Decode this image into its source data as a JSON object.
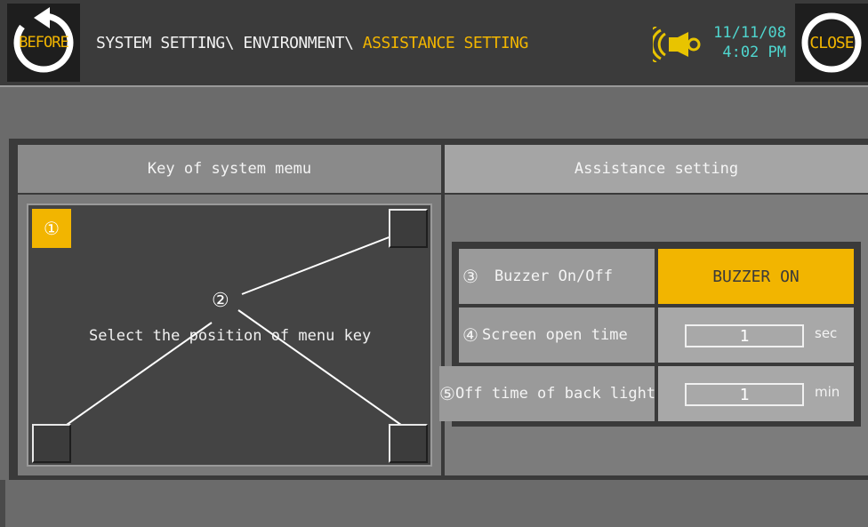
{
  "header": {
    "before_label": "BEFORE",
    "close_label": "CLOSE",
    "breadcrumb_path": "SYSTEM SETTING\\ ENVIRONMENT\\ ",
    "breadcrumb_current": "ASSISTANCE SETTING",
    "date": "11/11/08",
    "time": "4:02 PM",
    "buzzer_icon": "buzzer-icon"
  },
  "left_panel": {
    "title": "Key of system memu",
    "marker_1": "①",
    "marker_2": "②",
    "instruction": "Select the position of menu key"
  },
  "right_panel": {
    "title": "Assistance setting",
    "rows": [
      {
        "marker": "③",
        "label": "Buzzer On/Off",
        "value": "BUZZER ON"
      },
      {
        "marker": "④",
        "label": "Screen open time",
        "value": "1",
        "unit": "sec"
      },
      {
        "marker": "⑤",
        "label": "Off time of back light",
        "value": "1",
        "unit": "min"
      }
    ]
  },
  "colors": {
    "accent": "#f2b500",
    "clock": "#4fd6cf",
    "topbar": "#3b3b3b"
  }
}
